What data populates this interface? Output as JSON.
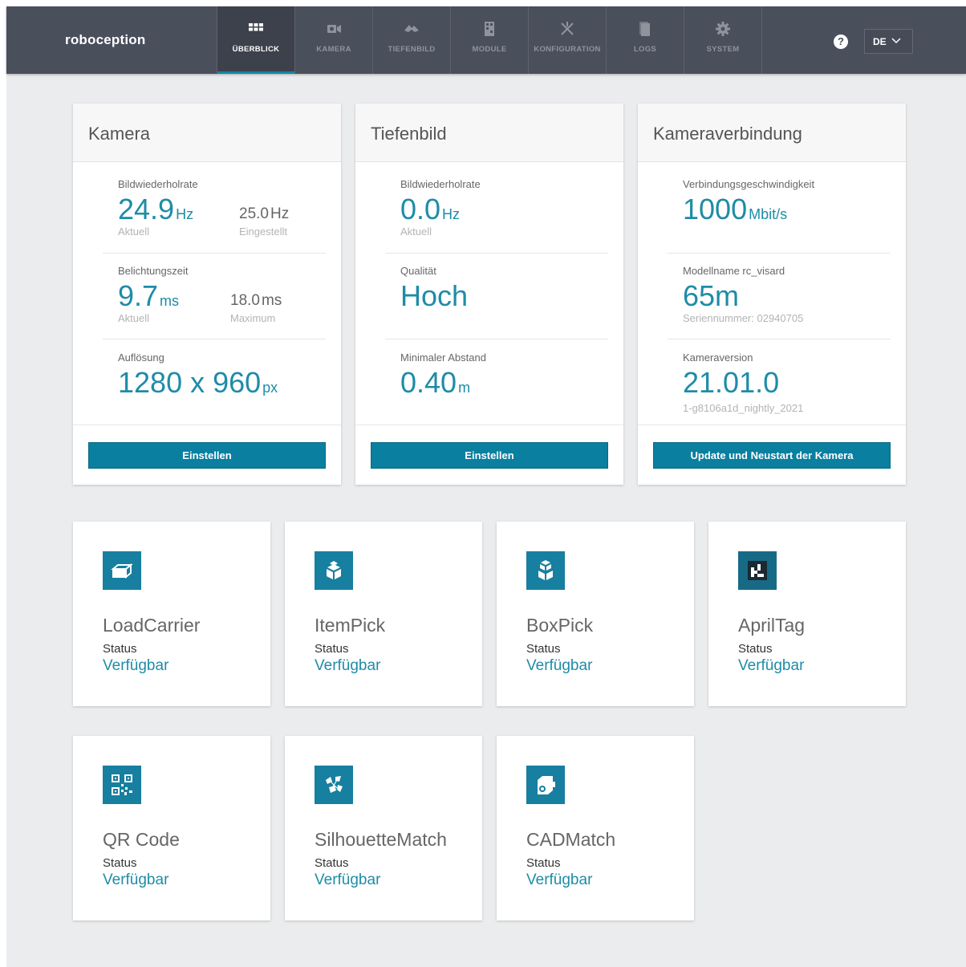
{
  "header": {
    "logo": "roboception",
    "nav": [
      {
        "label": "ÜBERBLICK",
        "icon": "grid-icon",
        "active": true
      },
      {
        "label": "KAMERA",
        "icon": "camera-icon",
        "active": false
      },
      {
        "label": "TIEFENBILD",
        "icon": "depth-image-icon",
        "active": false
      },
      {
        "label": "MODULE",
        "icon": "modules-icon",
        "active": false
      },
      {
        "label": "KONFIGURATION",
        "icon": "tools-icon",
        "active": false
      },
      {
        "label": "LOGS",
        "icon": "document-icon",
        "active": false
      },
      {
        "label": "SYSTEM",
        "icon": "gear-icon",
        "active": false
      }
    ],
    "help_icon": "?",
    "language": "DE"
  },
  "cards": {
    "camera": {
      "title": "Kamera",
      "framerate_label": "Bildwiederholrate",
      "framerate_value": "24.9",
      "framerate_unit": "Hz",
      "framerate_value_caption": "Aktuell",
      "framerate_set": "25.0",
      "framerate_set_unit": "Hz",
      "framerate_set_caption": "Eingestellt",
      "exposure_label": "Belichtungszeit",
      "exposure_value": "9.7",
      "exposure_unit": "ms",
      "exposure_value_caption": "Aktuell",
      "exposure_max": "18.0",
      "exposure_max_unit": "ms",
      "exposure_max_caption": "Maximum",
      "resolution_label": "Auflösung",
      "resolution_value": "1280 x 960",
      "resolution_unit": "px",
      "button": "Einstellen"
    },
    "depth": {
      "title": "Tiefenbild",
      "framerate_label": "Bildwiederholrate",
      "framerate_value": "0.0",
      "framerate_unit": "Hz",
      "framerate_caption": "Aktuell",
      "quality_label": "Qualität",
      "quality_value": "Hoch",
      "min_distance_label": "Minimaler Abstand",
      "min_distance_value": "0.40",
      "min_distance_unit": "m",
      "button": "Einstellen"
    },
    "connection": {
      "title": "Kameraverbindung",
      "speed_label": "Verbindungsgeschwindigkeit",
      "speed_value": "1000",
      "speed_unit": "Mbit/s",
      "model_label": "Modellname rc_visard",
      "model_value": "65m",
      "serial": "Seriennummer: 02940705",
      "version_label": "Kameraversion",
      "version_value": "21.01.0",
      "version_build": "1-g8106a1d_nightly_2021",
      "button": "Update und Neustart der Kamera"
    }
  },
  "modules": [
    {
      "name": "LoadCarrier",
      "status_label": "Status",
      "status": "Verfügbar",
      "icon": "load-carrier-icon"
    },
    {
      "name": "ItemPick",
      "status_label": "Status",
      "status": "Verfügbar",
      "icon": "item-pick-icon"
    },
    {
      "name": "BoxPick",
      "status_label": "Status",
      "status": "Verfügbar",
      "icon": "box-pick-icon"
    },
    {
      "name": "AprilTag",
      "status_label": "Status",
      "status": "Verfügbar",
      "icon": "april-tag-icon"
    },
    {
      "name": "QR Code",
      "status_label": "Status",
      "status": "Verfügbar",
      "icon": "qr-code-icon"
    },
    {
      "name": "SilhouetteMatch",
      "status_label": "Status",
      "status": "Verfügbar",
      "icon": "silhouette-match-icon"
    },
    {
      "name": "CADMatch",
      "status_label": "Status",
      "status": "Verfügbar",
      "icon": "cad-match-icon"
    }
  ],
  "colors": {
    "accent": "#1e8ca7",
    "button": "#0a7fa0",
    "header": "#4a4f5c",
    "background": "#ebeced"
  }
}
